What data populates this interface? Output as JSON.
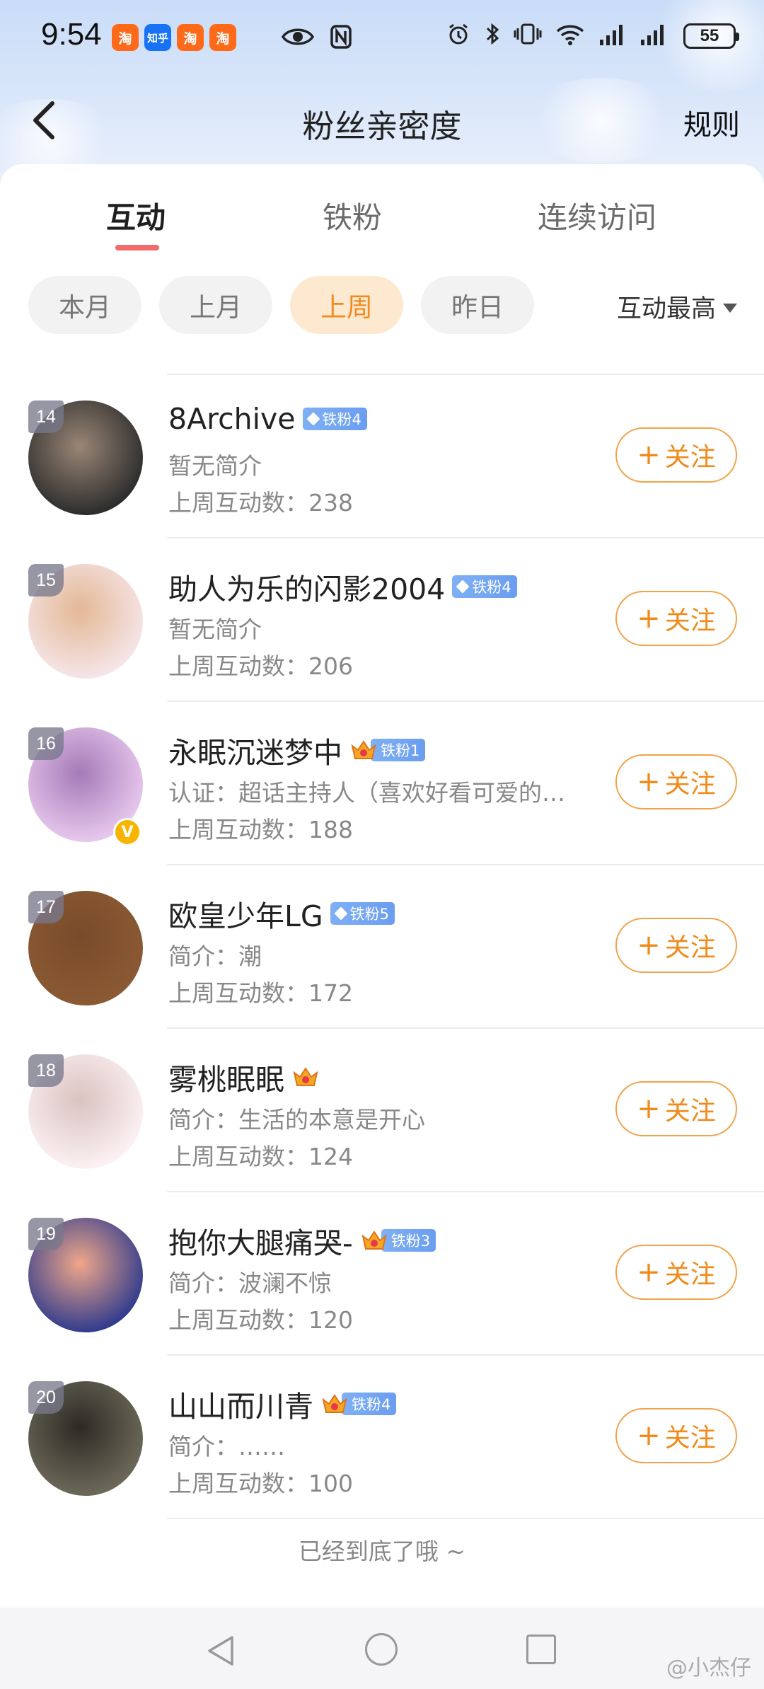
{
  "status_bar": {
    "time": "9:54",
    "apps": [
      {
        "label": "淘",
        "color": "#ff6a1a",
        "icon": "taobao-icon"
      },
      {
        "label": "知乎",
        "color": "#1772f6",
        "icon": "zhihu-icon"
      },
      {
        "label": "淘",
        "color": "#ff6a1a",
        "icon": "taobao-flash-icon"
      },
      {
        "label": "淘",
        "color": "#ff6a1a",
        "icon": "taobao-icon"
      }
    ],
    "battery": "55"
  },
  "header": {
    "title": "粉丝亲密度",
    "rules": "规则"
  },
  "tabs": [
    {
      "label": "互动",
      "active": true
    },
    {
      "label": "铁粉",
      "active": false
    },
    {
      "label": "连续访问",
      "active": false
    }
  ],
  "filters": [
    {
      "label": "本月",
      "active": false
    },
    {
      "label": "上月",
      "active": false
    },
    {
      "label": "上周",
      "active": true
    },
    {
      "label": "昨日",
      "active": false
    }
  ],
  "sort": {
    "label": "互动最高"
  },
  "follow_label": "关注",
  "fans": [
    {
      "rank": "14",
      "name": "8Archive",
      "badge_type": "gem",
      "badge": "铁粉4",
      "bio": "暂无简介",
      "stat": "上周互动数：238",
      "verified": false,
      "avatar_colors": [
        "#2b2b2b",
        "#9a8676"
      ]
    },
    {
      "rank": "15",
      "name": "助人为乐的闪影2004",
      "badge_type": "gem",
      "badge": "铁粉4",
      "bio": "暂无简介",
      "stat": "上周互动数：206",
      "verified": false,
      "avatar_colors": [
        "#f6e6ea",
        "#e3b894"
      ]
    },
    {
      "rank": "16",
      "name": "永眠沉迷梦中",
      "badge_type": "crown",
      "badge": "铁粉1",
      "bio": "认证：超话主持人（喜欢好看可爱的…",
      "stat": "上周互动数：188",
      "verified": true,
      "avatar_colors": [
        "#e8c9ee",
        "#a57ab8"
      ]
    },
    {
      "rank": "17",
      "name": "欧皇少年LG",
      "badge_type": "gem",
      "badge": "铁粉5",
      "bio": "简介：潮",
      "stat": "上周互动数：172",
      "verified": false,
      "avatar_colors": [
        "#8b5a34",
        "#7a4b2a"
      ]
    },
    {
      "rank": "18",
      "name": "雾桃眠眠",
      "badge_type": "crown-only",
      "badge": "",
      "bio": "简介：生活的本意是开心",
      "stat": "上周互动数：124",
      "verified": false,
      "avatar_colors": [
        "#fdf2f4",
        "#d9c3bf"
      ]
    },
    {
      "rank": "19",
      "name": "抱你大腿痛哭-",
      "badge_type": "crown",
      "badge": "铁粉3",
      "bio": "简介：波澜不惊",
      "stat": "上周互动数：120",
      "verified": false,
      "avatar_colors": [
        "#2e3a8c",
        "#f0a78a"
      ]
    },
    {
      "rank": "20",
      "name": "山山而川青",
      "badge_type": "crown",
      "badge": "铁粉4",
      "bio": "简介：……",
      "stat": "上周互动数：100",
      "verified": false,
      "avatar_colors": [
        "#6e6a5a",
        "#2c2a24"
      ]
    }
  ],
  "end_text": "已经到底了哦 ~",
  "watermark": "@小杰仔"
}
